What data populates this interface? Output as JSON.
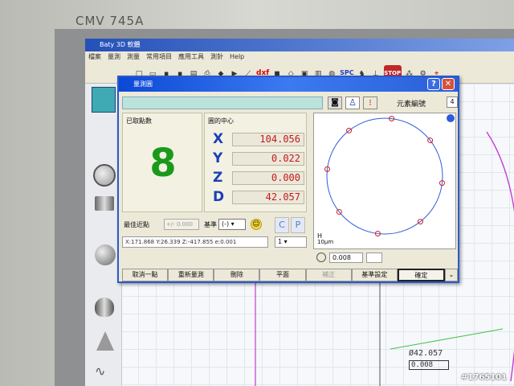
{
  "monitor": {
    "model": "CMV 745A"
  },
  "app": {
    "title": "Baty 3D 軟體",
    "menu": [
      "檔案",
      "量測",
      "測量",
      "常用項目",
      "應用工具",
      "測針",
      "Help"
    ],
    "toolbar": {
      "dxf": "dxf",
      "spc": "SPC",
      "stop": "STOP"
    }
  },
  "dialog": {
    "title": "量測圓",
    "help": "?",
    "close": "✕",
    "element_label": "元素編號",
    "element_value": "4",
    "points_label": "已取點數",
    "points_count": "8",
    "center_label": "圓的中心",
    "coords": [
      {
        "axis": "X",
        "value": "104.056"
      },
      {
        "axis": "Y",
        "value": "0.022"
      },
      {
        "axis": "Z",
        "value": "0.000"
      },
      {
        "axis": "D",
        "value": "42.057"
      }
    ],
    "best_fit_label": "最佳近點",
    "best_fit_value": "+/- 0.000",
    "datum_label": "基準",
    "datum_value": "(-)",
    "c_button": "C",
    "p_button": "P",
    "status_text": "X:171.868  Y:26.339  Z:-417.855  e:0.001",
    "select_value": "1",
    "plot_scale": "H",
    "plot_scale_unit": "10μm",
    "plot_value": "0.008",
    "buttons": [
      "取消一點",
      "重新量測",
      "刪除",
      "平面",
      "補正",
      "基準設定",
      "確定"
    ],
    "plot": {
      "points": 8,
      "accent": "#2f5bd8",
      "point_color": "#d02020"
    }
  },
  "canvas": {
    "diameter_label": "Ø42.057",
    "tolerance_label": "0.008"
  },
  "watermark": "#1765101",
  "icons": [
    "camera-icon",
    "walking-person-icon",
    "traffic-light-icon",
    "smile-icon",
    "circle-icon",
    "cylinder-icon",
    "cone-icon",
    "sphere-icon",
    "wave-icon"
  ]
}
